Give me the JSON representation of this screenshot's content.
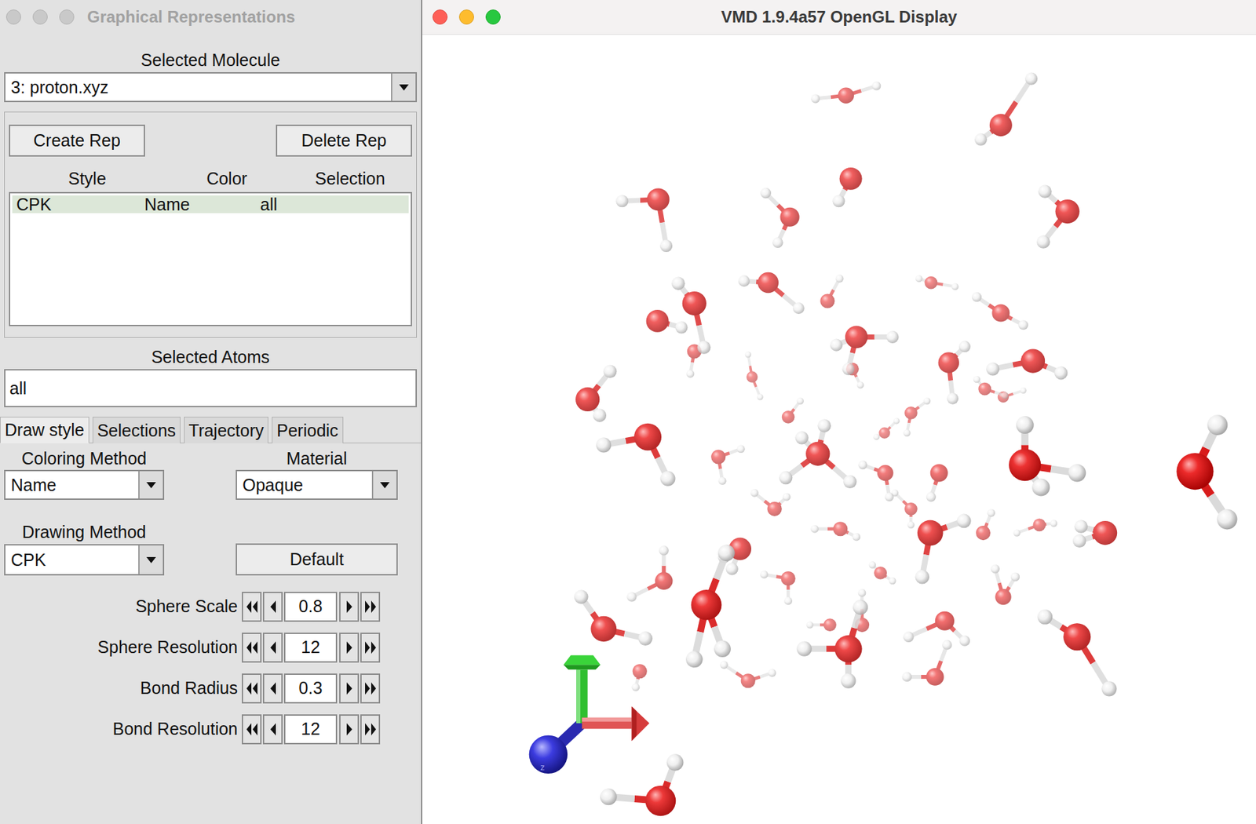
{
  "panel": {
    "title": "Graphical Representations"
  },
  "molecule": {
    "label": "Selected Molecule",
    "value": "3: proton.xyz"
  },
  "rep_buttons": [
    "Create Rep",
    "Delete Rep"
  ],
  "reps": {
    "columns": [
      "Style",
      "Color",
      "Selection"
    ],
    "rows": [
      {
        "cells": [
          "CPK",
          "Name",
          "all"
        ],
        "selected": true
      }
    ]
  },
  "selected_atoms": {
    "label": "Selected Atoms",
    "value": "all"
  },
  "tabs": [
    {
      "label": "Draw style",
      "selected": true
    },
    {
      "label": "Selections",
      "selected": false
    },
    {
      "label": "Trajectory",
      "selected": false
    },
    {
      "label": "Periodic",
      "selected": false
    }
  ],
  "coloring": {
    "label": "Coloring Method",
    "value": "Name"
  },
  "material": {
    "label": "Material",
    "value": "Opaque"
  },
  "drawing": {
    "label": "Drawing Method",
    "value": "CPK"
  },
  "default_button": "Default",
  "params": [
    {
      "label": "Sphere Scale",
      "value": "0.8"
    },
    {
      "label": "Sphere Resolution",
      "value": "12"
    },
    {
      "label": "Bond Radius",
      "value": "0.3"
    },
    {
      "label": "Bond Resolution",
      "value": "12"
    }
  ],
  "display": {
    "title": "VMD 1.9.4a57 OpenGL Display",
    "axis_label": "z"
  }
}
